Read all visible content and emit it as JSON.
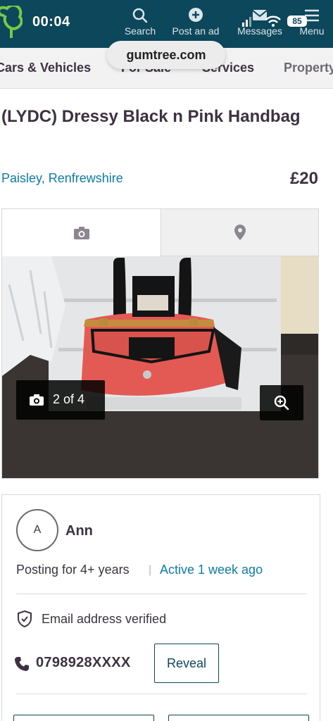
{
  "status_bar": {
    "time": "00:04",
    "battery": "85"
  },
  "nav": {
    "search_label": "Search",
    "post_label": "Post an ad",
    "messages_label": "Messages",
    "menu_label": "Menu"
  },
  "url_pill": "gumtree.com",
  "categories": [
    "Cars & Vehicles",
    "For Sale",
    "Services",
    "Property"
  ],
  "listing": {
    "title": "(LYDC) Dressy Black n Pink Handbag",
    "location": "Paisley, Renfrewshire",
    "price": "£20"
  },
  "gallery": {
    "counter": "2 of 4",
    "tabs": [
      "photos-tab",
      "map-tab"
    ]
  },
  "seller": {
    "initial": "A",
    "name": "Ann",
    "posting_for": "Posting for 4+ years",
    "active": "Active 1 week ago",
    "verified": "Email address verified",
    "phone": "0798928XXXX",
    "reveal_label": "Reveal"
  },
  "colors": {
    "brand_dark": "#0d475c",
    "link": "#0b7fa8",
    "text": "#3c3241"
  }
}
